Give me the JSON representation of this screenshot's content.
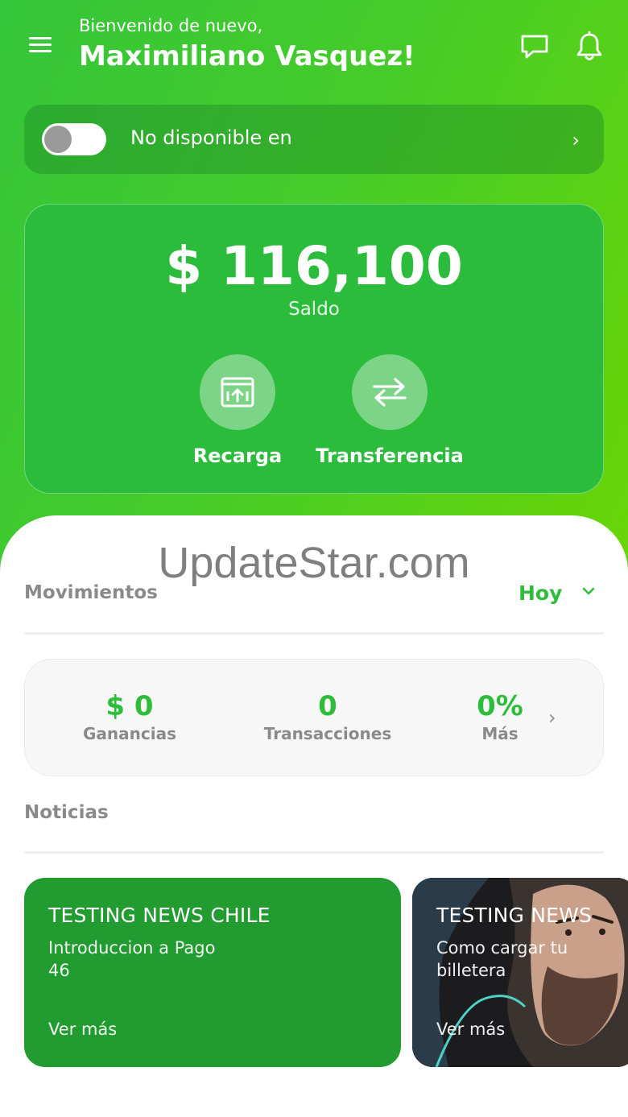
{
  "header": {
    "welcome": "Bienvenido de nuevo,",
    "username": "Maximiliano Vasquez!",
    "icons": [
      "menu-icon",
      "chat-icon",
      "bell-icon"
    ]
  },
  "availability": {
    "label": "No disponible en",
    "toggle_on": false,
    "chevron": "›"
  },
  "balance": {
    "amount": "$ 116,100",
    "label": "Saldo",
    "actions": [
      {
        "label": "Recarga",
        "icon": "upload-icon"
      },
      {
        "label": "Transferencia",
        "icon": "transfer-arrows-icon"
      }
    ]
  },
  "watermark": "UpdateStar.com",
  "movements": {
    "title": "Movimientos",
    "period": "Hoy",
    "stats": [
      {
        "value": "$ 0",
        "label": "Ganancias"
      },
      {
        "value": "0",
        "label": "Transacciones"
      },
      {
        "value": "0%",
        "label": "Más"
      }
    ],
    "chevron": "›"
  },
  "news": {
    "title": "Noticias",
    "items": [
      {
        "title": "TESTING NEWS CHILE",
        "description_line1": "Introduccion a Pago",
        "description_line2": "46",
        "link": "Ver más"
      },
      {
        "title": "TESTING NEWS",
        "description_line1": "Como cargar tu",
        "description_line2": "billetera",
        "link": "Ver más"
      }
    ]
  },
  "colors": {
    "primary_green": "#2ebd3a",
    "gradient_start": "#34c53a",
    "gradient_end": "#6ad605",
    "news_card_green": "#229b30",
    "muted_text": "#8a8a8a"
  }
}
